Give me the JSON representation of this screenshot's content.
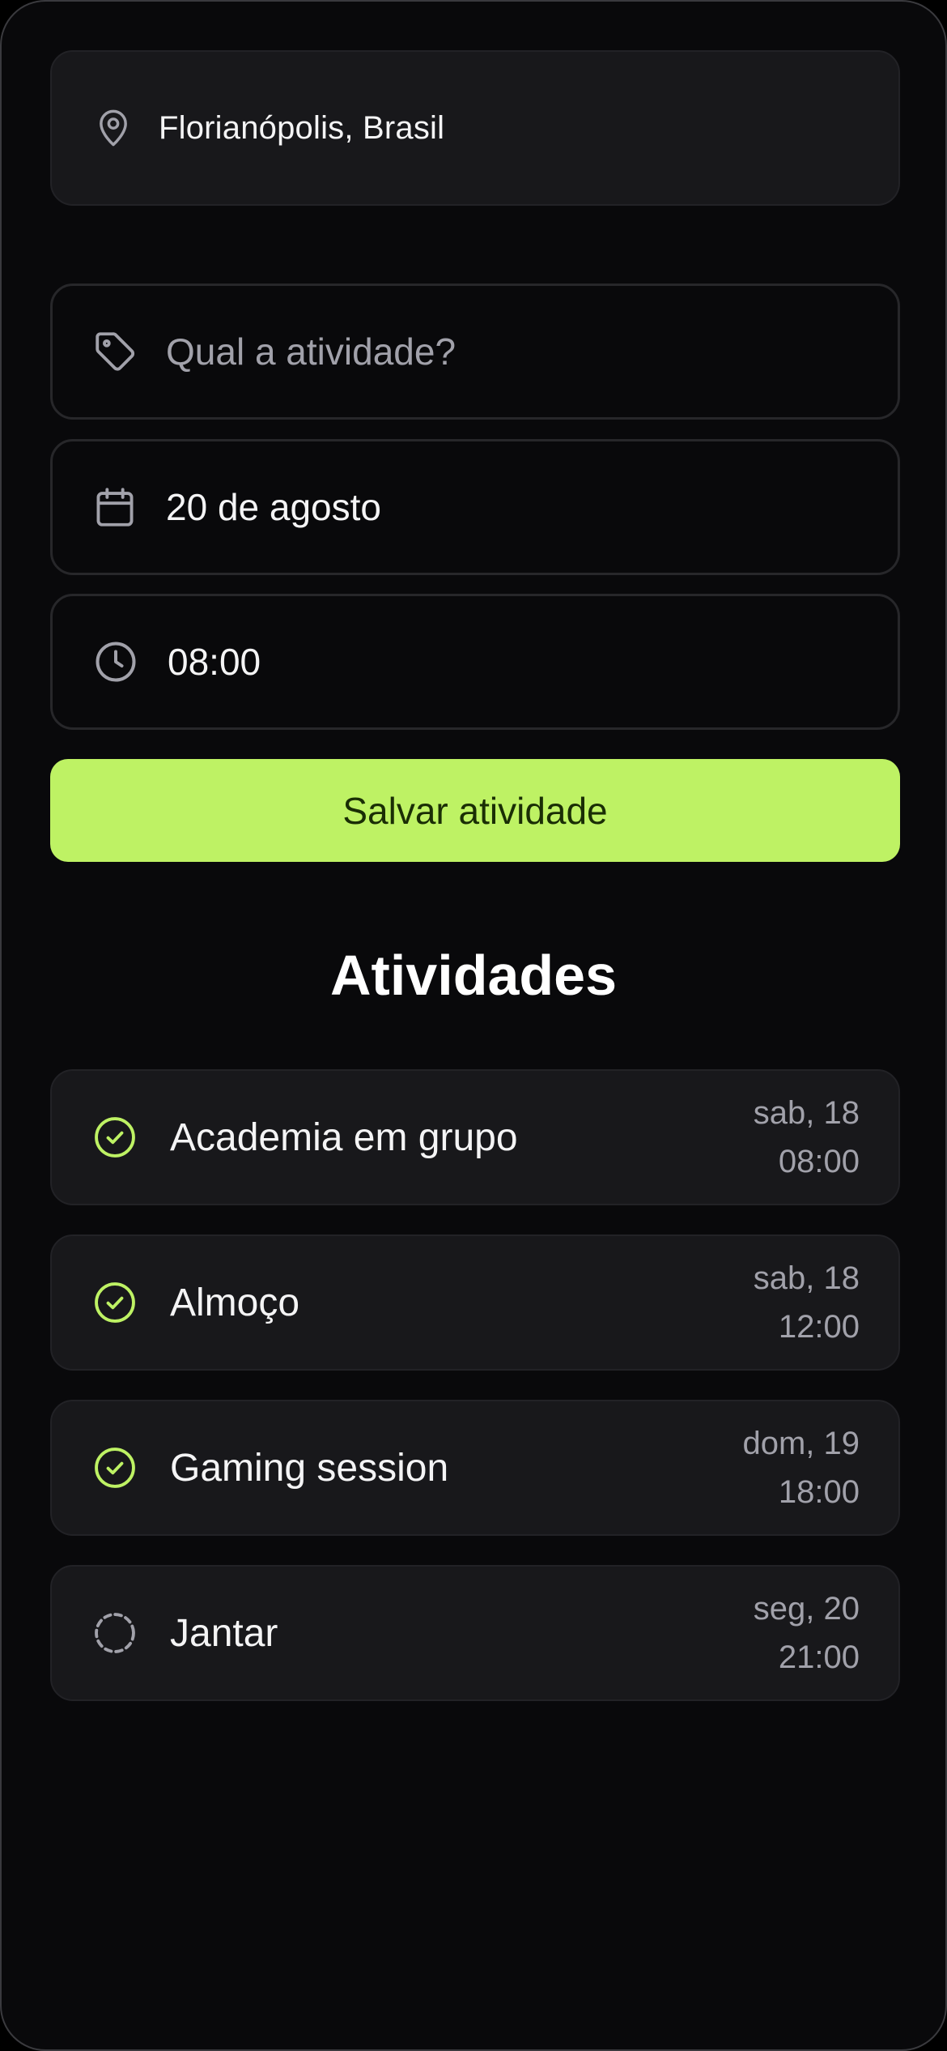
{
  "location": {
    "icon": "map-pin-icon",
    "text": "Florianópolis, Brasil"
  },
  "form": {
    "activity": {
      "icon": "tag-icon",
      "placeholder": "Qual a atividade?",
      "value": ""
    },
    "date": {
      "icon": "calendar-icon",
      "value": "20 de agosto"
    },
    "time": {
      "icon": "clock-icon",
      "value": "08:00"
    },
    "save_label": "Salvar atividade"
  },
  "activities": {
    "title": "Atividades",
    "items": [
      {
        "title": "Academia em grupo",
        "day": "sab, 18",
        "time": "08:00",
        "done": true,
        "icon": "check-circle-icon"
      },
      {
        "title": "Almoço",
        "day": "sab, 18",
        "time": "12:00",
        "done": true,
        "icon": "check-circle-icon"
      },
      {
        "title": "Gaming session",
        "day": "dom, 19",
        "time": "18:00",
        "done": true,
        "icon": "check-circle-icon"
      },
      {
        "title": "Jantar",
        "day": "seg, 20",
        "time": "21:00",
        "done": false,
        "icon": "dashed-circle-icon"
      }
    ]
  },
  "colors": {
    "background": "#09090b",
    "card": "#18181b",
    "border": "#27272a",
    "accent": "#bef264",
    "text": "#f4f4f5",
    "muted": "#a1a1aa"
  }
}
